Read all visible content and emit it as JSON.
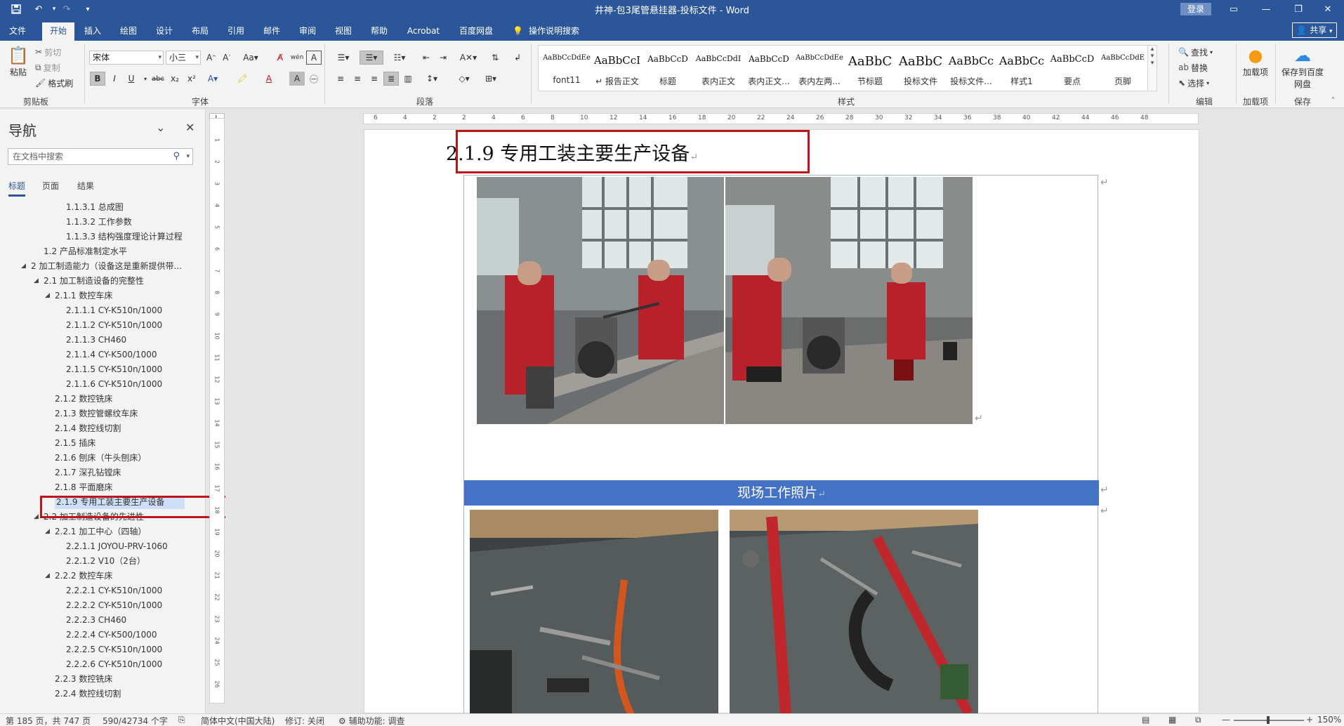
{
  "window": {
    "title": "井神-包3尾管悬挂器-投标文件  -  Word",
    "login_label": "登录"
  },
  "quick_access": {
    "save_icon": "save-icon",
    "undo_icon": "undo-icon",
    "redo_icon": "redo-icon",
    "customize_icon": "customize-icon"
  },
  "tabs": [
    "文件",
    "开始",
    "插入",
    "绘图",
    "设计",
    "布局",
    "引用",
    "邮件",
    "审阅",
    "视图",
    "帮助",
    "Acrobat",
    "百度网盘"
  ],
  "active_tab": "开始",
  "tell_me": "操作说明搜索",
  "share_label": "共享",
  "ribbon": {
    "clipboard": {
      "paste": "粘贴",
      "cut": "剪切",
      "copy": "复制",
      "format_painter": "格式刷",
      "label": "剪贴板"
    },
    "font": {
      "font_name": "宋体",
      "font_size": "小三",
      "label": "字体"
    },
    "paragraph": {
      "label": "段落"
    },
    "styles": {
      "label": "样式",
      "items": [
        {
          "sample": "AaBbCcDdEe",
          "name": "font11"
        },
        {
          "sample": "AaBbCcI",
          "name": "↵ 报告正文"
        },
        {
          "sample": "AaBbCcD",
          "name": "标题"
        },
        {
          "sample": "AaBbCcDdI",
          "name": "表内正文"
        },
        {
          "sample": "AaBbCcD",
          "name": "表内正文..."
        },
        {
          "sample": "AaBbCcDdEe",
          "name": "表内左两..."
        },
        {
          "sample": "AaBbC",
          "name": "节标题"
        },
        {
          "sample": "AaBbC",
          "name": "投标文件"
        },
        {
          "sample": "AaBbCc",
          "name": "投标文件..."
        },
        {
          "sample": "AaBbCc",
          "name": "样式1"
        },
        {
          "sample": "AaBbCcD",
          "name": "要点"
        },
        {
          "sample": "AaBbCcDdE",
          "name": "页脚"
        }
      ]
    },
    "editing": {
      "find": "查找",
      "replace": "替换",
      "select": "选择",
      "label": "编辑"
    },
    "addins": {
      "load": "加载项",
      "label": "加载项"
    },
    "save_group": {
      "save_baidu": "保存到百度网盘",
      "label": "保存"
    }
  },
  "nav": {
    "title": "导航",
    "search_placeholder": "在文档中搜索",
    "tabs": [
      "标题",
      "页面",
      "结果"
    ],
    "items": [
      {
        "text": "1.1.3.1 总成图",
        "level": 4
      },
      {
        "text": "1.1.3.2 工作参数",
        "level": 4
      },
      {
        "text": "1.1.3.3 结构强度理论计算过程",
        "level": 4
      },
      {
        "text": "1.2 产品标准制定水平",
        "level": 2
      },
      {
        "text": "2 加工制造能力（设备这是重新提供带...",
        "level": 1,
        "expanded": true
      },
      {
        "text": "2.1 加工制造设备的完整性",
        "level": 2,
        "expanded": true
      },
      {
        "text": "2.1.1 数控车床",
        "level": 3,
        "expanded": true
      },
      {
        "text": "2.1.1.1 CY-K510n/1000",
        "level": 4
      },
      {
        "text": "2.1.1.2 CY-K510n/1000",
        "level": 4
      },
      {
        "text": "2.1.1.3 CH460",
        "level": 4
      },
      {
        "text": "2.1.1.4 CY-K500/1000",
        "level": 4
      },
      {
        "text": "2.1.1.5 CY-K510n/1000",
        "level": 4
      },
      {
        "text": "2.1.1.6 CY-K510n/1000",
        "level": 4
      },
      {
        "text": "2.1.2 数控铣床",
        "level": 3
      },
      {
        "text": "2.1.3 数控管螺纹车床",
        "level": 3
      },
      {
        "text": "2.1.4 数控线切割",
        "level": 3
      },
      {
        "text": "2.1.5 插床",
        "level": 3
      },
      {
        "text": "2.1.6 刨床（牛头刨床）",
        "level": 3
      },
      {
        "text": "2.1.7 深孔钻镗床",
        "level": 3
      },
      {
        "text": "2.1.8 平面磨床",
        "level": 3
      },
      {
        "text": "2.1.9 专用工装主要生产设备",
        "level": 3,
        "selected": true
      },
      {
        "text": "2.2 加工制造设备的先进性",
        "level": 2,
        "expanded": true
      },
      {
        "text": "2.2.1 加工中心（四轴）",
        "level": 3,
        "expanded": true
      },
      {
        "text": "2.2.1.1 JOYOU-PRV-1060",
        "level": 4
      },
      {
        "text": "2.2.1.2 V10（2台）",
        "level": 4
      },
      {
        "text": "2.2.2 数控车床",
        "level": 3,
        "expanded": true
      },
      {
        "text": "2.2.2.1 CY-K510n/1000",
        "level": 4
      },
      {
        "text": "2.2.2.2 CY-K510n/1000",
        "level": 4
      },
      {
        "text": "2.2.2.3 CH460",
        "level": 4
      },
      {
        "text": "2.2.2.4 CY-K500/1000",
        "level": 4
      },
      {
        "text": "2.2.2.5 CY-K510n/1000",
        "level": 4
      },
      {
        "text": "2.2.2.6 CY-K510n/1000",
        "level": 4
      },
      {
        "text": "2.2.3 数控铣床",
        "level": 3
      },
      {
        "text": "2.2.4 数控线切割",
        "level": 3
      }
    ]
  },
  "ruler": {
    "h_ticks": [
      "6",
      "4",
      "2",
      "2",
      "4",
      "6",
      "8",
      "10",
      "12",
      "14",
      "16",
      "18",
      "20",
      "22",
      "24",
      "26",
      "28",
      "30",
      "32",
      "34",
      "36",
      "38",
      "40",
      "42",
      "44",
      "46",
      "48"
    ],
    "v_ticks": [
      "1",
      "2",
      "3",
      "4",
      "5",
      "6",
      "7",
      "8",
      "9",
      "10",
      "11",
      "12",
      "13",
      "14",
      "15",
      "16",
      "17",
      "18",
      "19",
      "20",
      "21",
      "22",
      "23",
      "24",
      "25",
      "26"
    ],
    "corner": "L"
  },
  "document": {
    "heading": "2.1.9 专用工装主要生产设备",
    "caption": "现场工作照片"
  },
  "status": {
    "page": "第 185 页，共 747 页",
    "words": "590/42734 个字",
    "language": "简体中文(中国大陆)",
    "track": "修订: 关闭",
    "accessibility": "辅助功能: 调查",
    "zoom": "150%"
  },
  "colors": {
    "brand": "#2b579a",
    "highlight_box": "#c0141b",
    "caption_bar": "#4472c4"
  }
}
